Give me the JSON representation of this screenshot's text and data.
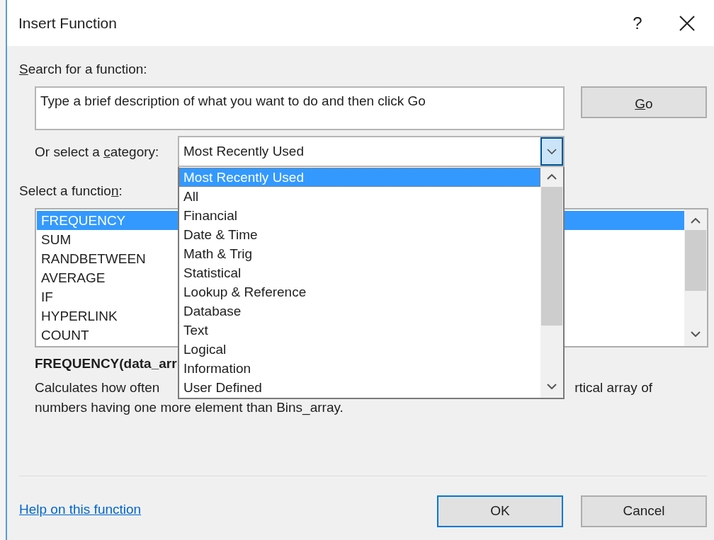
{
  "window": {
    "title": "Insert Function",
    "help_button": "?"
  },
  "search": {
    "label": {
      "key": "S",
      "post": "earch for a function:"
    },
    "placeholder": "Type a brief description of what you want to do and then click Go",
    "go_button": {
      "key": "G",
      "post": "o"
    }
  },
  "category": {
    "label": {
      "pre": "Or select a ",
      "key": "c",
      "post": "ategory:"
    },
    "value": "Most Recently Used",
    "expanded": true,
    "options": [
      {
        "label": "Most Recently Used",
        "selected": true
      },
      {
        "label": "All",
        "selected": false
      },
      {
        "label": "Financial",
        "selected": false
      },
      {
        "label": "Date & Time",
        "selected": false
      },
      {
        "label": "Math & Trig",
        "selected": false
      },
      {
        "label": "Statistical",
        "selected": false
      },
      {
        "label": "Lookup & Reference",
        "selected": false
      },
      {
        "label": "Database",
        "selected": false
      },
      {
        "label": "Text",
        "selected": false
      },
      {
        "label": "Logical",
        "selected": false
      },
      {
        "label": "Information",
        "selected": false
      },
      {
        "label": "User Defined",
        "selected": false
      }
    ]
  },
  "functions": {
    "label": {
      "pre": "Select a functio",
      "key": "n",
      "post": ":"
    },
    "items": [
      {
        "label": "FREQUENCY",
        "selected": true
      },
      {
        "label": "SUM",
        "selected": false
      },
      {
        "label": "RANDBETWEEN",
        "selected": false
      },
      {
        "label": "AVERAGE",
        "selected": false
      },
      {
        "label": "IF",
        "selected": false
      },
      {
        "label": "HYPERLINK",
        "selected": false
      },
      {
        "label": "COUNT",
        "selected": false
      }
    ]
  },
  "syntax": "FREQUENCY(data_arr",
  "description": {
    "line_1_start": "Calculates how often",
    "line_1_end": "rtical array of",
    "line_2": "numbers having one more element than Bins_array."
  },
  "help_link": "Help on this function",
  "buttons": [
    {
      "label": "OK",
      "default": true
    },
    {
      "label": "Cancel",
      "default": false
    }
  ]
}
